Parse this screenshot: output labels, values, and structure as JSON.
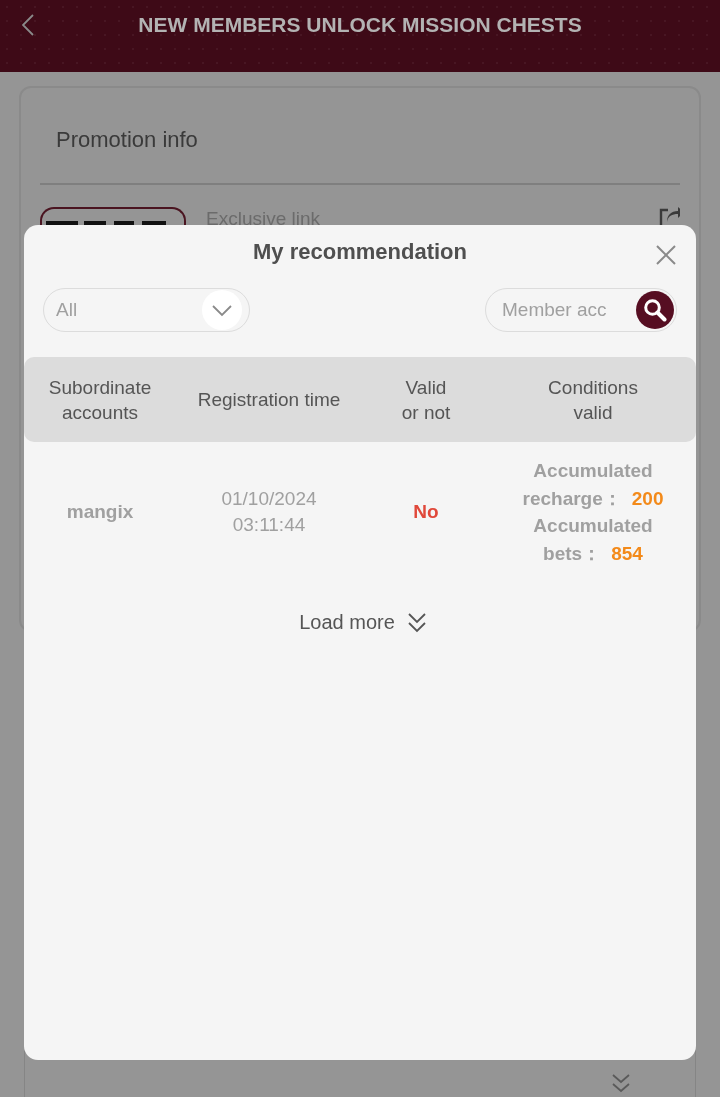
{
  "header": {
    "title": "NEW MEMBERS UNLOCK MISSION CHESTS"
  },
  "promotion_card": {
    "title": "Promotion info",
    "link_label": "Exclusive link"
  },
  "modal": {
    "title": "My recommendation",
    "filter": {
      "value": "All"
    },
    "search": {
      "placeholder": "Member acc"
    },
    "table": {
      "columns": [
        "Subordinate accounts",
        "Registration time",
        "Valid or not",
        "Conditions valid"
      ],
      "rows": [
        {
          "account": "mangix",
          "registration_time": "01/10/2024 03:11:44",
          "valid": {
            "text": "No",
            "valid": false
          },
          "conditions": [
            {
              "label": "Accumulated recharge：",
              "value": "200"
            },
            {
              "label": "Accumulated bets：",
              "value": "854"
            }
          ]
        }
      ]
    },
    "load_more": "Load more"
  }
}
